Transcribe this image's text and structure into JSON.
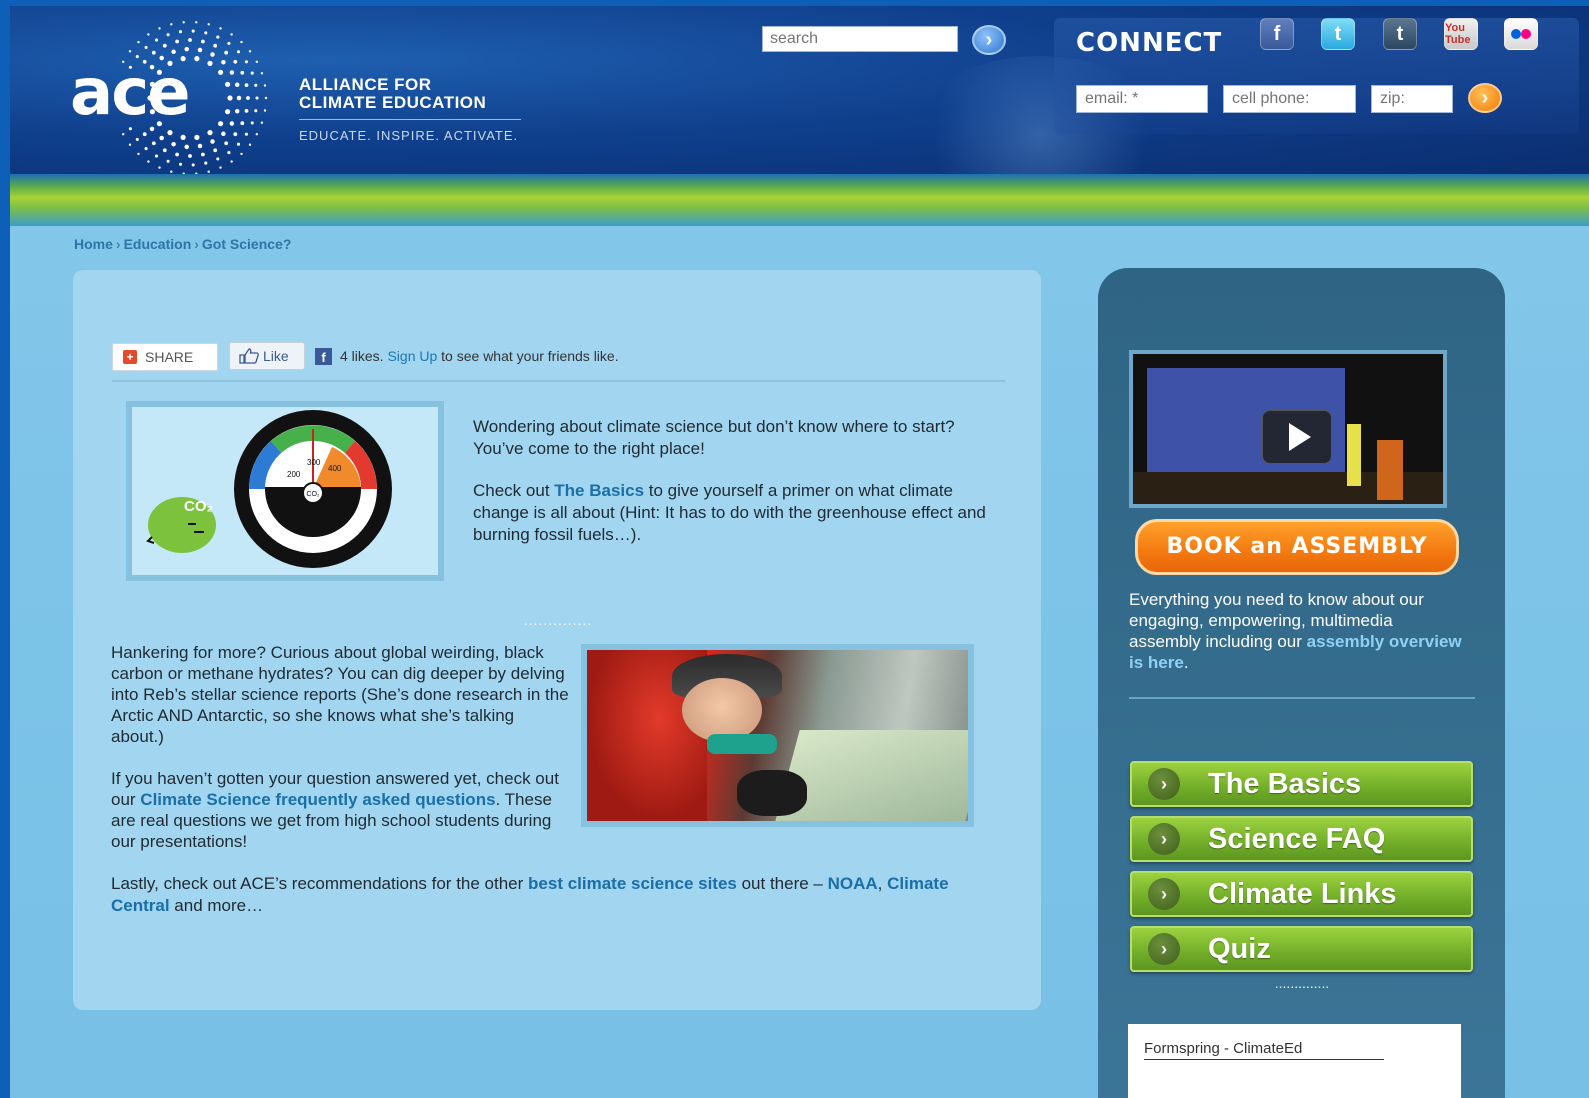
{
  "header": {
    "logo_word": "ace",
    "tagline_line1": "ALLIANCE FOR",
    "tagline_line2": "CLIMATE EDUCATION",
    "tagline_motto": "EDUCATE. INSPIRE. ACTIVATE.",
    "search_placeholder": "search",
    "search_button": "›",
    "connect_title": "CONNECT",
    "social_icons": [
      "facebook-icon",
      "twitter-icon",
      "tumblr-icon",
      "youtube-icon",
      "flickr-icon"
    ],
    "facebook_glyph": "f",
    "twitter_glyph": "t",
    "tumblr_glyph": "t",
    "youtube_glyph": "You Tube",
    "email_placeholder": "email: *",
    "cell_placeholder": "cell phone:",
    "zip_placeholder": "zip:",
    "connect_button": "›"
  },
  "breadcrumb": {
    "items": [
      "Home",
      "Education",
      "Got Science?"
    ],
    "separator": "›"
  },
  "share_bar": {
    "share_label": "SHARE",
    "like_label": "Like",
    "likes_count": "4 likes.",
    "signup_link": "Sign Up",
    "likes_suffix": "to see what your friends like."
  },
  "gauge": {
    "co2_label": "CO₂",
    "ticks": [
      "200",
      "300",
      "400"
    ],
    "center_label": "CO₂"
  },
  "intro": {
    "p1": "Wondering about climate science but don’t know where to start? You’ve come to the right place!",
    "p2_before": "Check out ",
    "p2_link": "The Basics",
    "p2_after": " to give yourself a primer on what climate change is all about (Hint: It has to do with the greenhouse effect and burning fossil fuels…)."
  },
  "divider": "..............",
  "more": {
    "p1": "Hankering for more? Curious about global weirding, black carbon or methane hydrates? You can dig deeper by delving into Reb’s stellar science reports (She’s done research in the Arctic AND Antarctic, so she knows what she’s talking about.)",
    "p2_before": "If you haven’t gotten your question answered yet, check out our ",
    "p2_link": "Climate Science frequently asked questions",
    "p2_after": ". These are real questions we get from high school students during our presentations!"
  },
  "lastly": {
    "before": "Lastly, check out ACE’s recommendations for the other ",
    "link1": "best climate science sites",
    "middle": " out there – ",
    "link2": "NOAA",
    "comma": ", ",
    "link3": "Climate Central",
    "after": " and more…"
  },
  "sidebar": {
    "book_button": "BOOK an ASSEMBLY",
    "assembly_text": "Everything you need to know about our engaging, empowering, multimedia assembly including our ",
    "assembly_link": "assembly overview is here",
    "assembly_end": ".",
    "buttons": [
      {
        "label": "The Basics"
      },
      {
        "label": "Science FAQ"
      },
      {
        "label": "Climate Links"
      },
      {
        "label": "Quiz"
      }
    ],
    "chevron": "›",
    "dots": "..............",
    "formspring_title": "Formspring - ClimateEd"
  },
  "colors": {
    "header_bg": "#0f3f8c",
    "content_bg": "#a2d5ef",
    "sidebar_bg": "#3a6f8f",
    "link": "#1a78b5",
    "green_button": "#74b02a",
    "orange_button": "#f37a10"
  }
}
